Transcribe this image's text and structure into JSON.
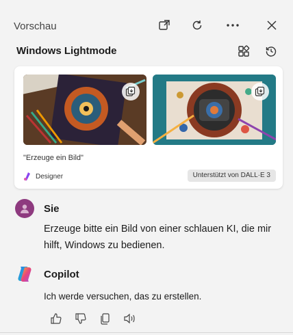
{
  "header": {
    "title": "Vorschau",
    "icons": [
      "open-external-icon",
      "refresh-icon",
      "more-icon",
      "close-icon"
    ]
  },
  "subheader": {
    "title": "Windows Lightmode",
    "icons": [
      "apps-icon",
      "history-icon"
    ]
  },
  "image_card": {
    "prompt": "\"Erzeuge ein Bild\"",
    "source_label": "Designer",
    "badge": "Unterstützt von DALL·E 3"
  },
  "messages": {
    "user": {
      "name": "Sie",
      "text": "Erzeuge bitte ein Bild von einer schlauen KI, die mir hilft, Windows zu bedienen."
    },
    "copilot": {
      "name": "Copilot",
      "text": "Ich werde versuchen, das zu erstellen."
    }
  },
  "colors": {
    "background": "#f3f3f3",
    "user_avatar": "#8e3a7f",
    "badge_bg": "#e6e6e6"
  }
}
